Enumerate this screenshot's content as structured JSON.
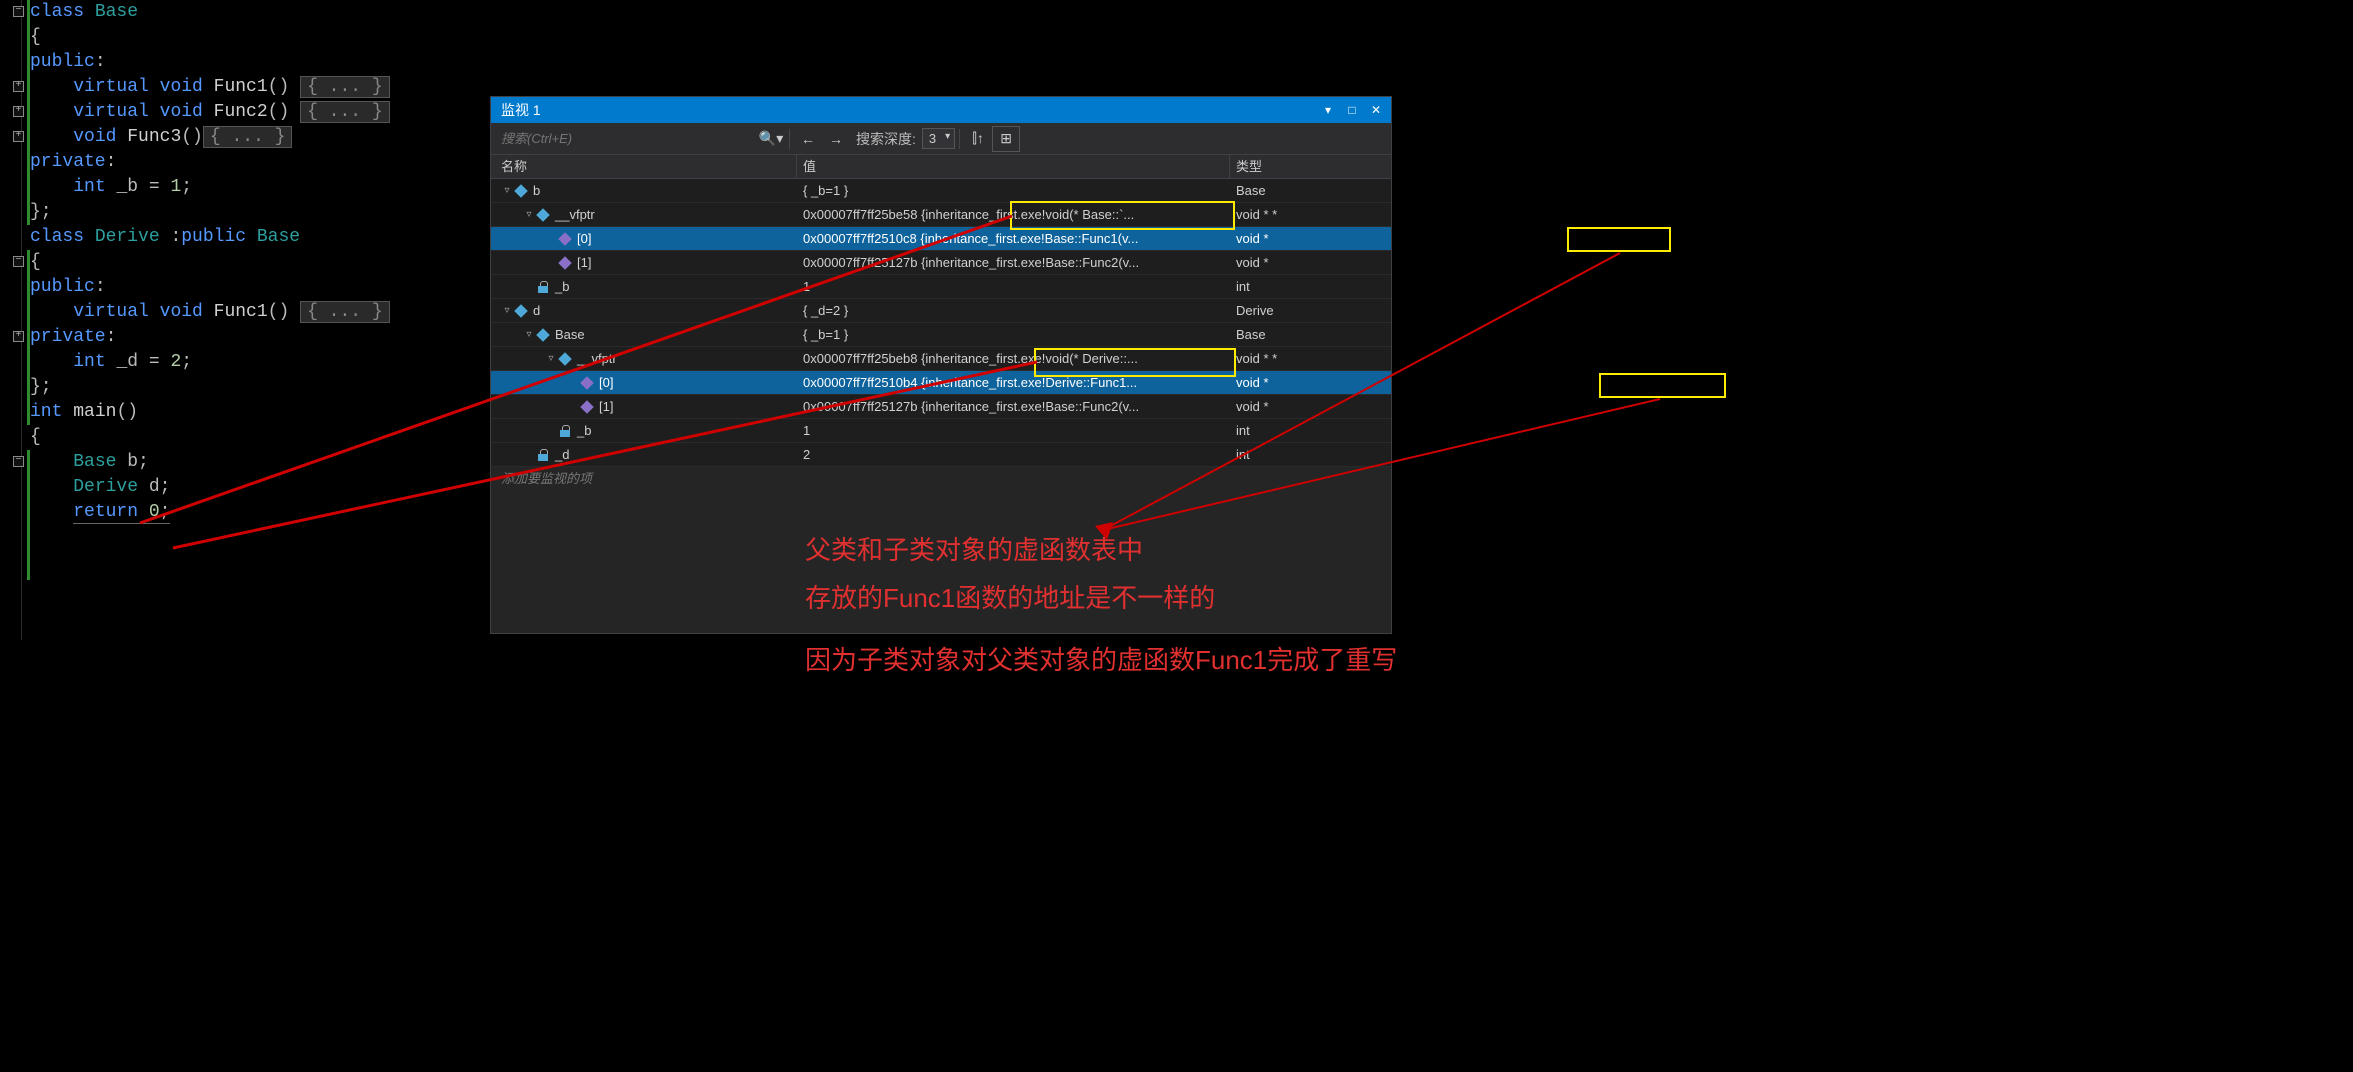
{
  "code": {
    "lines": [
      {
        "indent": 0,
        "tokens": [
          {
            "t": "class ",
            "c": "kw"
          },
          {
            "t": "Base",
            "c": "type"
          }
        ]
      },
      {
        "indent": 0,
        "tokens": [
          {
            "t": "{",
            "c": "punct"
          }
        ]
      },
      {
        "indent": 0,
        "tokens": [
          {
            "t": "public",
            "c": "kw"
          },
          {
            "t": ":",
            "c": "punct"
          }
        ]
      },
      {
        "indent": 1,
        "tokens": [
          {
            "t": "virtual ",
            "c": "kw"
          },
          {
            "t": "void ",
            "c": "kw"
          },
          {
            "t": "Func1",
            "c": "func"
          },
          {
            "t": "() ",
            "c": "punct"
          }
        ],
        "box": "{ ... }"
      },
      {
        "indent": 1,
        "tokens": [
          {
            "t": "virtual ",
            "c": "kw"
          },
          {
            "t": "void ",
            "c": "kw"
          },
          {
            "t": "Func2",
            "c": "func"
          },
          {
            "t": "() ",
            "c": "punct"
          }
        ],
        "box": "{ ... }"
      },
      {
        "indent": 1,
        "tokens": [
          {
            "t": "void ",
            "c": "kw"
          },
          {
            "t": "Func3",
            "c": "func"
          },
          {
            "t": "()",
            "c": "punct"
          }
        ],
        "box": "{ ... }"
      },
      {
        "indent": 0,
        "tokens": [
          {
            "t": "private",
            "c": "kw"
          },
          {
            "t": ":",
            "c": "punct"
          }
        ]
      },
      {
        "indent": 1,
        "tokens": [
          {
            "t": "int ",
            "c": "kw"
          },
          {
            "t": "_b ",
            "c": "punct"
          },
          {
            "t": "= ",
            "c": "punct"
          },
          {
            "t": "1",
            "c": "num"
          },
          {
            "t": ";",
            "c": "punct"
          }
        ]
      },
      {
        "indent": 0,
        "tokens": [
          {
            "t": "};",
            "c": "punct"
          }
        ]
      },
      {
        "indent": 0,
        "tokens": []
      },
      {
        "indent": 0,
        "tokens": [
          {
            "t": "class ",
            "c": "kw"
          },
          {
            "t": "Derive ",
            "c": "type"
          },
          {
            "t": ":",
            "c": "punct"
          },
          {
            "t": "public ",
            "c": "kw"
          },
          {
            "t": "Base",
            "c": "type"
          }
        ]
      },
      {
        "indent": 0,
        "tokens": [
          {
            "t": "{",
            "c": "punct"
          }
        ]
      },
      {
        "indent": 0,
        "tokens": [
          {
            "t": "public",
            "c": "kw"
          },
          {
            "t": ":",
            "c": "punct"
          }
        ]
      },
      {
        "indent": 1,
        "tokens": [
          {
            "t": "virtual ",
            "c": "kw"
          },
          {
            "t": "void ",
            "c": "kw"
          },
          {
            "t": "Func1",
            "c": "func"
          },
          {
            "t": "() ",
            "c": "punct"
          }
        ],
        "box": "{ ... }"
      },
      {
        "indent": 0,
        "tokens": [
          {
            "t": "private",
            "c": "kw"
          },
          {
            "t": ":",
            "c": "punct"
          }
        ]
      },
      {
        "indent": 1,
        "tokens": [
          {
            "t": "int ",
            "c": "kw"
          },
          {
            "t": "_d ",
            "c": "punct"
          },
          {
            "t": "= ",
            "c": "punct"
          },
          {
            "t": "2",
            "c": "num"
          },
          {
            "t": ";",
            "c": "punct"
          }
        ]
      },
      {
        "indent": 0,
        "tokens": [
          {
            "t": "};",
            "c": "punct"
          }
        ]
      },
      {
        "indent": 0,
        "tokens": []
      },
      {
        "indent": 0,
        "tokens": [
          {
            "t": "int ",
            "c": "kw"
          },
          {
            "t": "main",
            "c": "func"
          },
          {
            "t": "()",
            "c": "punct"
          }
        ]
      },
      {
        "indent": 0,
        "tokens": [
          {
            "t": "{",
            "c": "punct"
          }
        ]
      },
      {
        "indent": 1,
        "tokens": [
          {
            "t": "Base ",
            "c": "type"
          },
          {
            "t": "b",
            "c": "punct"
          },
          {
            "t": ";",
            "c": "punct"
          }
        ]
      },
      {
        "indent": 1,
        "tokens": [
          {
            "t": "Derive ",
            "c": "type"
          },
          {
            "t": "d",
            "c": "punct"
          },
          {
            "t": ";",
            "c": "punct"
          }
        ]
      },
      {
        "indent": 1,
        "tokens": [
          {
            "t": "return ",
            "c": "kw",
            "underline": true
          },
          {
            "t": "0",
            "c": "num",
            "underline": true
          },
          {
            "t": ";",
            "c": "punct",
            "underline": true
          }
        ]
      }
    ],
    "gutter_collapsed": [
      "−",
      "+",
      "+",
      "+",
      "−",
      "+",
      "−"
    ]
  },
  "watch": {
    "title": "监视 1",
    "search_placeholder": "搜索(Ctrl+E)",
    "depth_label": "搜索深度:",
    "depth_value": "3",
    "columns": {
      "name": "名称",
      "value": "值",
      "type": "类型"
    },
    "rows": [
      {
        "depth": 0,
        "exp": "▿",
        "icon": "cube",
        "name": "b",
        "value": "{ _b=1 }",
        "type": "Base"
      },
      {
        "depth": 1,
        "exp": "▿",
        "icon": "cube",
        "name": "__vfptr",
        "value": "0x00007ff7ff25be58 {inheritance_first.exe!void(* Base::`...",
        "type": "void * *"
      },
      {
        "depth": 2,
        "exp": "",
        "icon": "cube-purple",
        "name": "[0]",
        "value": "0x00007ff7ff2510c8 {inheritance_first.exe!Base::Func1(v...",
        "type": "void *",
        "sel": true
      },
      {
        "depth": 2,
        "exp": "",
        "icon": "cube-purple",
        "name": "[1]",
        "value": "0x00007ff7ff25127b {inheritance_first.exe!Base::Func2(v...",
        "type": "void *"
      },
      {
        "depth": 1,
        "exp": "",
        "icon": "lock",
        "name": "_b",
        "value": "1",
        "type": "int"
      },
      {
        "depth": 0,
        "exp": "▿",
        "icon": "cube",
        "name": "d",
        "value": "{ _d=2 }",
        "type": "Derive"
      },
      {
        "depth": 1,
        "exp": "▿",
        "icon": "cube",
        "name": "Base",
        "value": "{ _b=1 }",
        "type": "Base"
      },
      {
        "depth": 2,
        "exp": "▿",
        "icon": "cube",
        "name": "__vfptr",
        "value": "0x00007ff7ff25beb8 {inheritance_first.exe!void(* Derive::...",
        "type": "void * *"
      },
      {
        "depth": 3,
        "exp": "",
        "icon": "cube-purple",
        "name": "[0]",
        "value": "0x00007ff7ff2510b4 {inheritance_first.exe!Derive::Func1...",
        "type": "void *",
        "sel": true
      },
      {
        "depth": 3,
        "exp": "",
        "icon": "cube-purple",
        "name": "[1]",
        "value": "0x00007ff7ff25127b {inheritance_first.exe!Base::Func2(v...",
        "type": "void *"
      },
      {
        "depth": 2,
        "exp": "",
        "icon": "lock",
        "name": "_b",
        "value": "1",
        "type": "int"
      },
      {
        "depth": 1,
        "exp": "",
        "icon": "lock",
        "name": "_d",
        "value": "2",
        "type": "int"
      }
    ],
    "add_item": "添加要监视的项"
  },
  "annotations": {
    "line1": "父类和子类对象的虚函数表中",
    "line2": "存放的Func1函数的地址是不一样的",
    "line3": "因为子类对象对父类对象的虚函数Func1完成了重写"
  }
}
